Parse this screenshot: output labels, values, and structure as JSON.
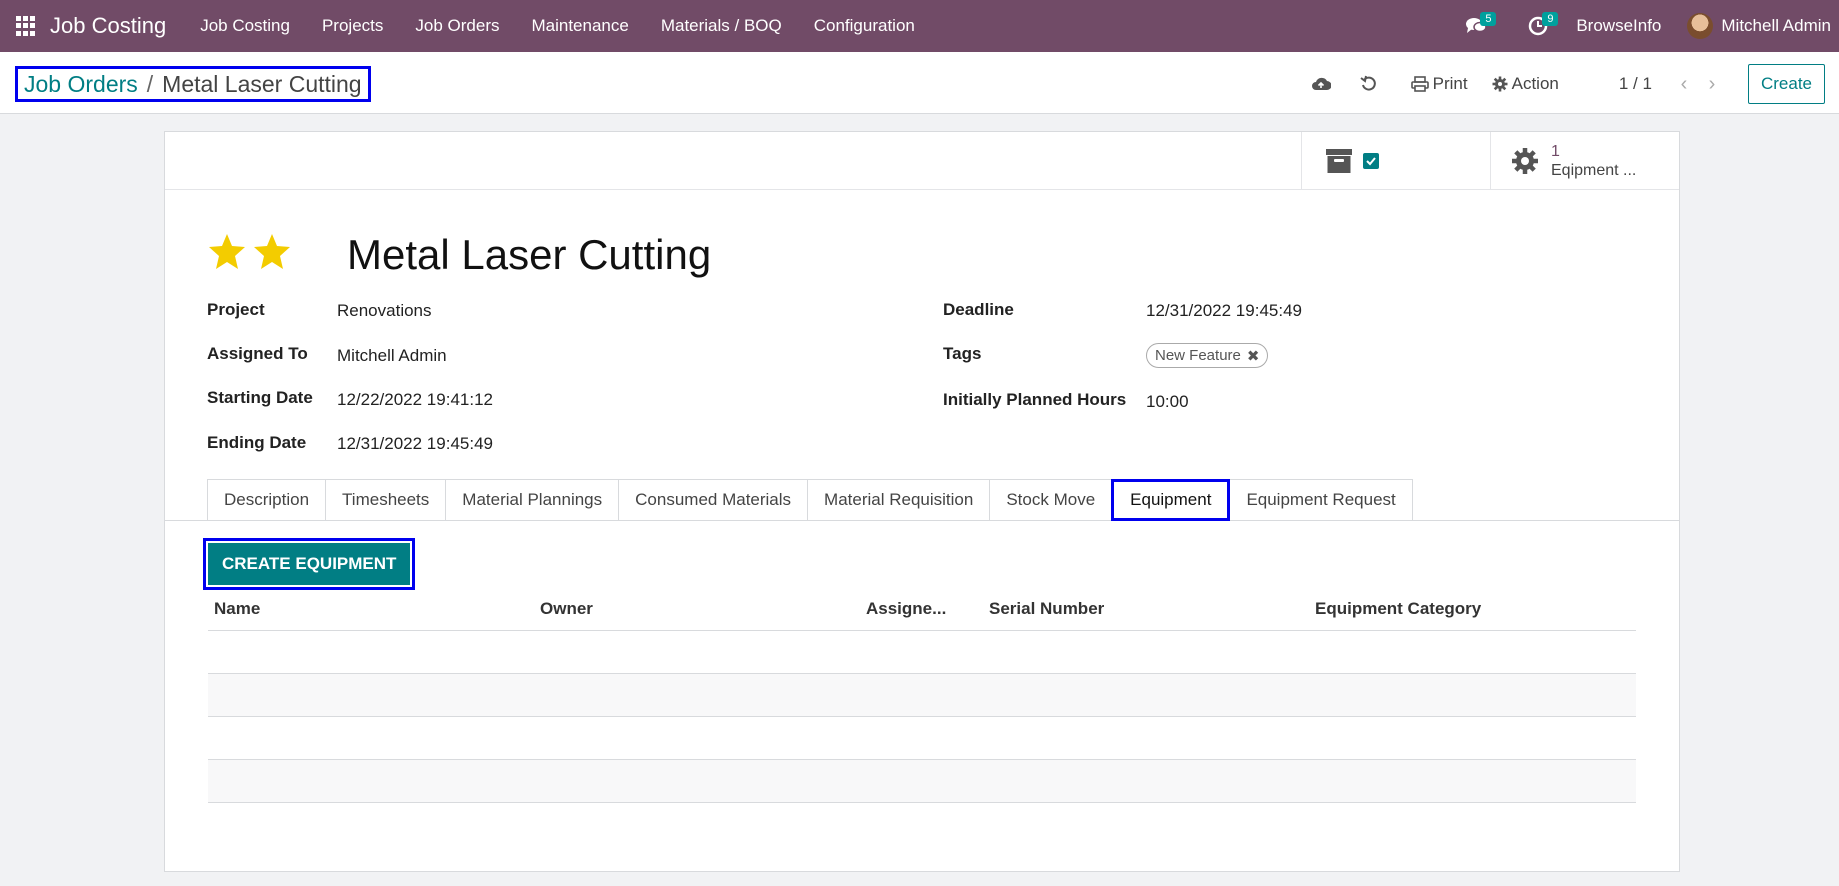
{
  "navbar": {
    "brand": "Job Costing",
    "menu": [
      "Job Costing",
      "Projects",
      "Job Orders",
      "Maintenance",
      "Materials / BOQ",
      "Configuration"
    ],
    "messages_count": "5",
    "activities_count": "9",
    "company": "BrowseInfo",
    "user": "Mitchell Admin"
  },
  "breadcrumb": {
    "parent": "Job Orders",
    "separator": "/",
    "current": "Metal Laser Cutting"
  },
  "control_panel": {
    "print_label": "Print",
    "action_label": "Action",
    "pager": "1 / 1",
    "create_label": "Create"
  },
  "button_box": {
    "equipment_count": "1",
    "equipment_label": "Eqipment ..."
  },
  "record": {
    "title": "Metal Laser Cutting",
    "priority_stars": 2,
    "left_fields": [
      {
        "label": "Project",
        "value": "Renovations"
      },
      {
        "label": "Assigned To",
        "value": "Mitchell Admin"
      },
      {
        "label": "Starting Date",
        "value": "12/22/2022 19:41:12"
      },
      {
        "label": "Ending Date",
        "value": "12/31/2022 19:45:49"
      }
    ],
    "right_fields": [
      {
        "label": "Deadline",
        "value": "12/31/2022 19:45:49"
      },
      {
        "label": "Tags",
        "value": ""
      },
      {
        "label": "Initially Planned Hours",
        "value": "10:00"
      }
    ],
    "tag": "New Feature"
  },
  "tabs": [
    "Description",
    "Timesheets",
    "Material Plannings",
    "Consumed Materials",
    "Material Requisition",
    "Stock Move",
    "Equipment",
    "Equipment Request"
  ],
  "active_tab": "Equipment",
  "equipment": {
    "create_button": "CREATE EQUIPMENT",
    "columns": [
      "Name",
      "Owner",
      "Assigne...",
      "Serial Number",
      "Equipment Category"
    ],
    "rows": []
  },
  "colors": {
    "navbar": "#714b67",
    "accent": "#017e84",
    "badge": "#00a09d",
    "highlight": "#0000ee"
  }
}
